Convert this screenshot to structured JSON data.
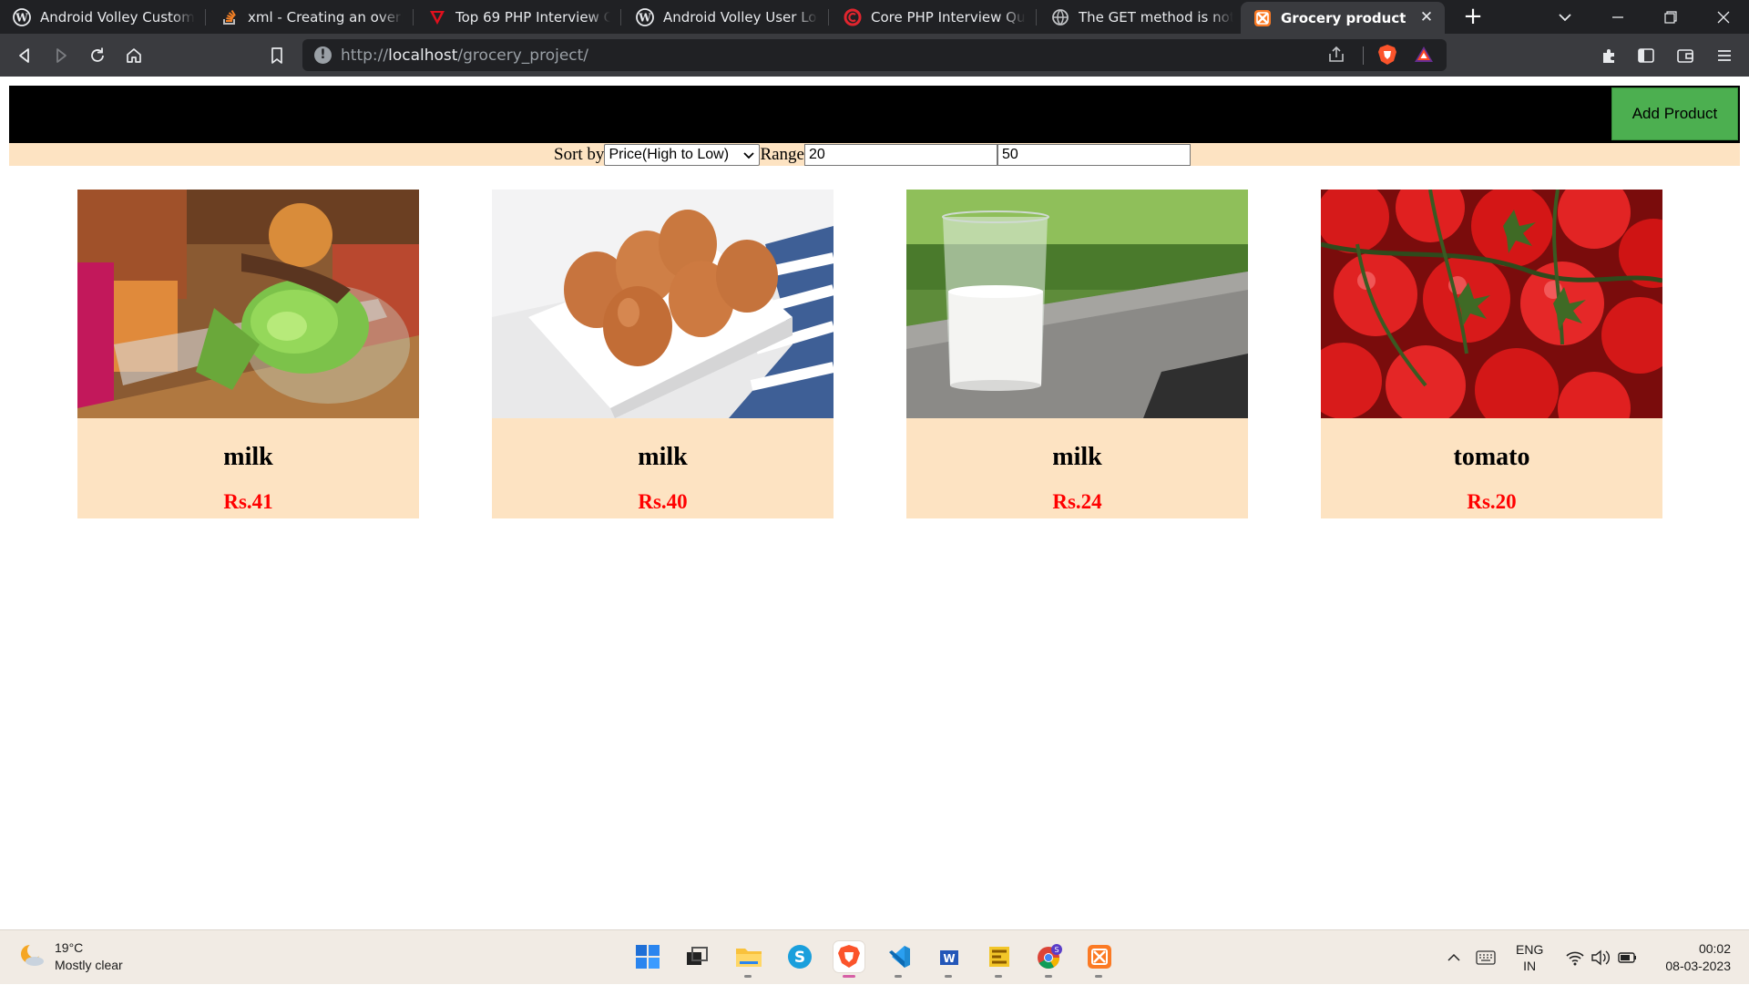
{
  "browser": {
    "tabs": [
      {
        "title": "Android Volley Custom JSON",
        "icon": "wordpress-icon"
      },
      {
        "title": "xml - Creating an overlay in",
        "icon": "stackoverflow-icon"
      },
      {
        "title": "Top 69 PHP Interview Ques",
        "icon": "red-v-icon"
      },
      {
        "title": "Android Volley User Login S",
        "icon": "wordpress-icon"
      },
      {
        "title": "Core PHP Interview Questio",
        "icon": "red-c-icon"
      },
      {
        "title": "The GET method is not sup",
        "icon": "globe-icon"
      },
      {
        "title": "Grocery product",
        "icon": "xampp-icon",
        "active": true
      }
    ],
    "url_prefix": "http://",
    "url_host": "localhost",
    "url_path": "/grocery_project/"
  },
  "page": {
    "add_button": "Add Product",
    "sort_label": "Sort by",
    "sort_selected": "Price(High to Low)",
    "range_label": "Range",
    "range_min": "20",
    "range_max": "50",
    "products": [
      {
        "name": "milk",
        "price": "Rs.41",
        "image": "lettuce-photo"
      },
      {
        "name": "milk",
        "price": "Rs.40",
        "image": "eggs-photo"
      },
      {
        "name": "milk",
        "price": "Rs.24",
        "image": "milk-glass-photo"
      },
      {
        "name": "tomato",
        "price": "Rs.20",
        "image": "tomatoes-photo"
      }
    ],
    "colors": {
      "header": "#000000",
      "filter_bg": "#fde3c2",
      "add_button": "#4caf50",
      "price": "#ff0000"
    }
  },
  "taskbar": {
    "temperature": "19°C",
    "weather": "Mostly clear",
    "lang_top": "ENG",
    "lang_bottom": "IN",
    "time": "00:02",
    "date": "08-03-2023"
  }
}
